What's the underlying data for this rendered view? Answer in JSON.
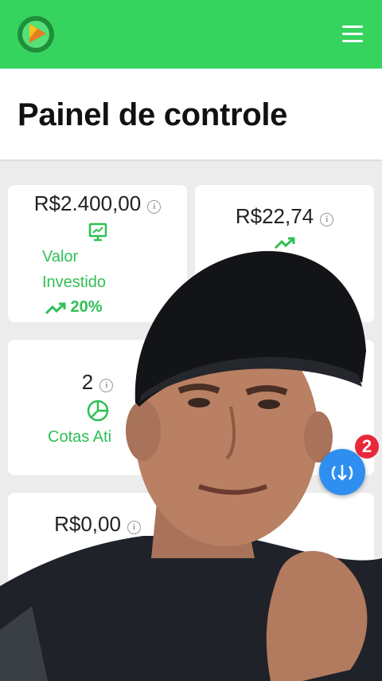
{
  "header": {
    "title": "Painel de controle"
  },
  "cards": [
    {
      "amount": "R$2.400,00",
      "label_line1": "Valor",
      "label_line2": "Investido",
      "change": "20%",
      "icon": "presentation-chart-icon"
    },
    {
      "amount": "R$22,74",
      "icon": "trending-up-icon"
    },
    {
      "amount": "2",
      "label": "Cotas Ati",
      "icon": "pie-chart-icon"
    },
    {
      "amount": "R$0,00"
    }
  ],
  "fab": {
    "icon": "download-icon",
    "badge": "2"
  },
  "colors": {
    "brand": "#36d45e",
    "accent": "#2fbf55",
    "fab": "#2f8ff0",
    "badge": "#e8283a"
  }
}
